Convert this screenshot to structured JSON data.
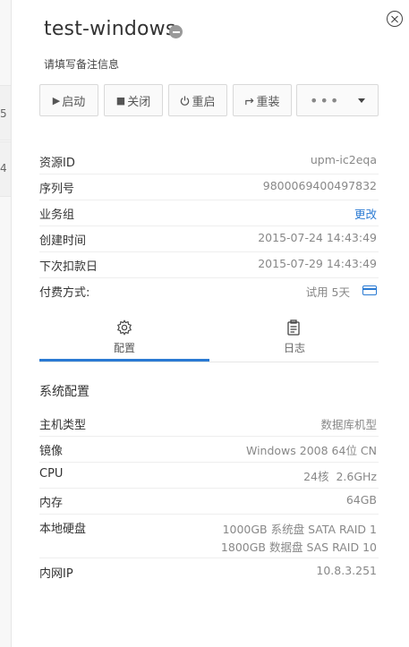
{
  "bg_edge": {
    "chars": [
      "5",
      "4"
    ]
  },
  "header": {
    "title": "test-windows",
    "remark": "请填写备注信息"
  },
  "toolbar": {
    "start_label": "启动",
    "stop_label": "关闭",
    "restart_label": "重启",
    "reinstall_label": "重装",
    "more_label": "•••"
  },
  "info": {
    "resource_id_label": "资源ID",
    "resource_id_value": "upm-ic2eqa",
    "serial_label": "序列号",
    "serial_value": "9800069400497832",
    "group_label": "业务组",
    "group_action": "更改",
    "created_label": "创建时间",
    "created_value": "2015-07-24 14:43:49",
    "next_charge_label": "下次扣款日",
    "next_charge_value": "2015-07-29 14:43:49",
    "payment_label": "付费方式:",
    "payment_value": "试用 5天"
  },
  "tabs": [
    {
      "label": "配置",
      "icon": "gear-icon",
      "active": true
    },
    {
      "label": "日志",
      "icon": "clipboard-icon",
      "active": false
    }
  ],
  "config": {
    "section_title": "系统配置",
    "host_type_label": "主机类型",
    "host_type_value": "数据库机型",
    "image_label": "镜像",
    "image_value": "Windows 2008 64位 CN",
    "cpu_label": "CPU",
    "cpu_value": "24核  2.6GHz",
    "memory_label": "内存",
    "memory_value": "64GB",
    "disk_label": "本地硬盘",
    "disk_value_1": "1000GB 系统盘 SATA RAID 1",
    "disk_value_2": "1800GB 数据盘 SAS RAID 10",
    "ip_label": "内网IP",
    "ip_value": "10.8.3.251"
  },
  "colors": {
    "accent": "#2a7ad3",
    "status_gray": "#999999"
  }
}
